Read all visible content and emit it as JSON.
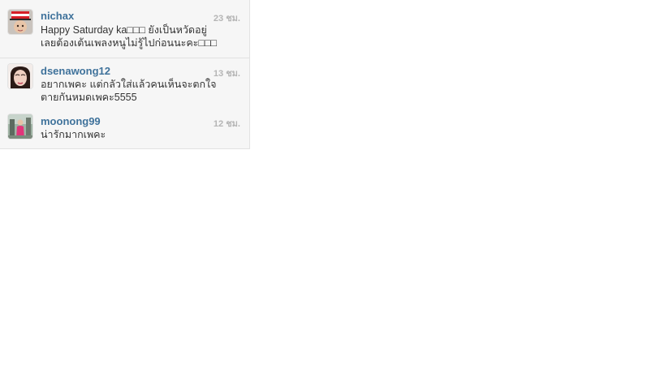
{
  "comments": [
    {
      "username": "nichax",
      "time": "23 ชม.",
      "text_lines": [
        "Happy Saturday ka□□□ ยังเป็นหวัดอยู่",
        "เลยต้องเต้นเพลงหนูไม่รู้ไปก่อนนะคะ□□□"
      ],
      "avatar_icon": "user-avatar-striped-hat"
    },
    {
      "username": "dsenawong12",
      "time": "13 ชม.",
      "text_lines": [
        "อยากเพคะ แต่กลัวใส่แล้วคนเห็นจะตกใจ",
        "ตายกันหมดเพคะ5555"
      ],
      "avatar_icon": "user-avatar-face"
    },
    {
      "username": "moonong99",
      "time": "12 ชม.",
      "text_lines": [
        "น่ารักมากเพคะ"
      ],
      "avatar_icon": "user-avatar-outdoor"
    }
  ],
  "colors": {
    "username": "#3f729b",
    "timestamp": "#b5b5b5",
    "text": "#333333",
    "panel_background": "#f6f6f6"
  }
}
